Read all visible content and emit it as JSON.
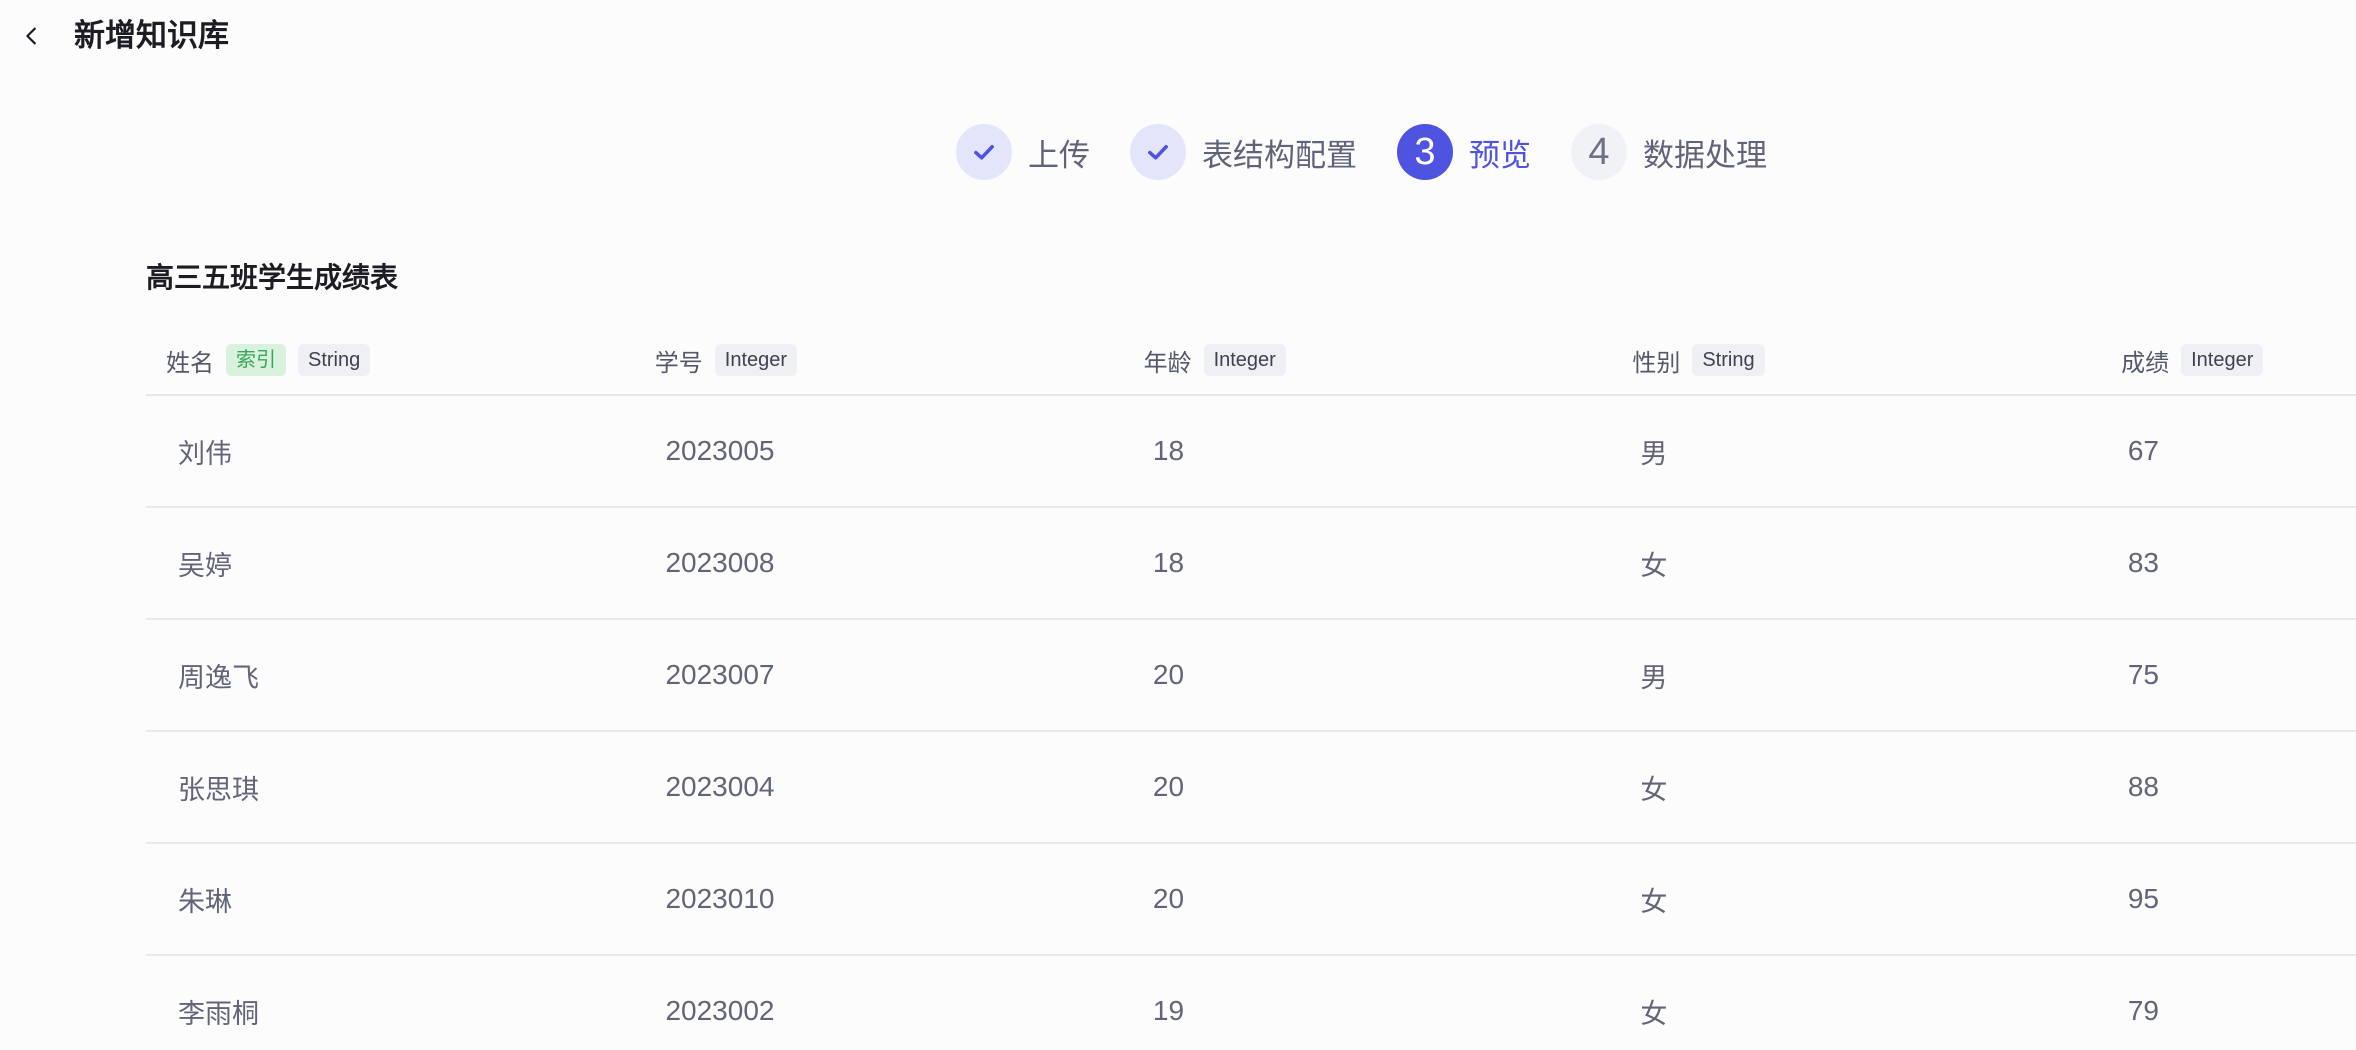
{
  "header": {
    "title": "新增知识库",
    "back_icon": "chevron-left-icon"
  },
  "steps": [
    {
      "label": "上传",
      "state": "done",
      "icon": "check-icon"
    },
    {
      "label": "表结构配置",
      "state": "done",
      "icon": "check-icon"
    },
    {
      "number": "3",
      "label": "预览",
      "state": "active"
    },
    {
      "number": "4",
      "label": "数据处理",
      "state": "pending"
    }
  ],
  "table": {
    "title": "高三五班学生成绩表",
    "columns": [
      {
        "name": "姓名",
        "index_tag": "索引",
        "type": "String"
      },
      {
        "name": "学号",
        "type": "Integer"
      },
      {
        "name": "年龄",
        "type": "Integer"
      },
      {
        "name": "性别",
        "type": "String"
      },
      {
        "name": "成绩",
        "type": "Integer"
      }
    ],
    "rows": [
      [
        "刘伟",
        "2023005",
        "18",
        "男",
        "67"
      ],
      [
        "吴婷",
        "2023008",
        "18",
        "女",
        "83"
      ],
      [
        "周逸飞",
        "2023007",
        "20",
        "男",
        "75"
      ],
      [
        "张思琪",
        "2023004",
        "20",
        "女",
        "88"
      ],
      [
        "朱琳",
        "2023010",
        "20",
        "女",
        "95"
      ],
      [
        "李雨桐",
        "2023002",
        "19",
        "女",
        "79"
      ]
    ]
  },
  "colors": {
    "accent": "#4e53e0",
    "done_bg": "#e3e5fb",
    "index_tag_bg": "#d8f2de",
    "index_tag_text": "#3aa65a"
  }
}
